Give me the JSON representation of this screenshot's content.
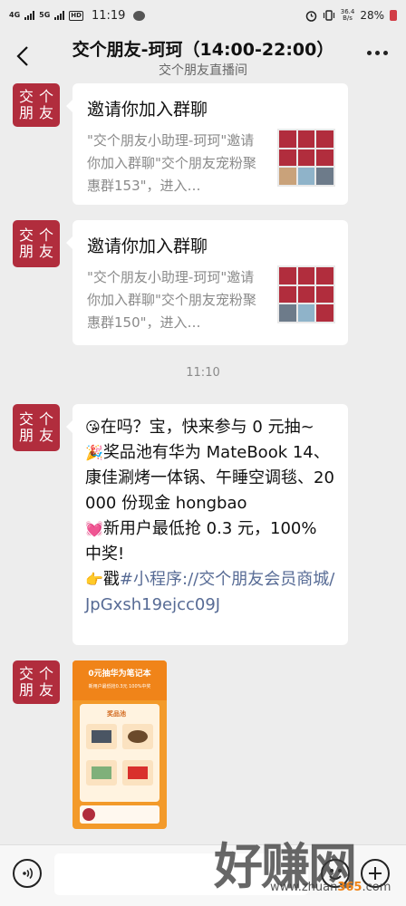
{
  "status_bar": {
    "network_1": "4G",
    "network_2": "5G",
    "hd": "HD",
    "time": "11:19",
    "speed_value": "36.4",
    "speed_unit": "B/s",
    "battery": "28%"
  },
  "header": {
    "title": "交个朋友-珂珂（14:00-22:00）",
    "subtitle": "交个朋友直播间"
  },
  "avatar": {
    "chars": [
      "交",
      "个",
      "朋",
      "友"
    ]
  },
  "messages": {
    "card1": {
      "title": "邀请你加入群聊",
      "desc": "\"交个朋友小助理-珂珂\"邀请你加入群聊\"交个朋友宠粉聚惠群153\"，进入…"
    },
    "card2": {
      "title": "邀请你加入群聊",
      "desc": "\"交个朋友小助理-珂珂\"邀请你加入群聊\"交个朋友宠粉聚惠群150\"，进入…"
    },
    "timestamp": "11:10",
    "text": {
      "emoji1": "😘",
      "line1": "在吗？宝，快来参与 0 元抽~",
      "emoji2": "🎉",
      "line2": "奖品池有华为 MateBook 14、 康佳涮烤一体锅、午睡空调毯、20000 份现金 hongbao",
      "emoji3": "💓",
      "line3": "新用户最低抢 0.3 元，100% 中奖!",
      "emoji4": "👉",
      "line4_prefix": "戳",
      "link": "#小程序://交个朋友会员商城/JpGxsh19ejcc09J"
    },
    "poster": {
      "title": "0元抽华为笔记本",
      "subtitle": "新用户最低抢0.3元 100%中奖",
      "pool_label": "奖品池"
    }
  },
  "input_bar": {
    "placeholder": ""
  },
  "watermark": {
    "big": "好赚网",
    "small_prefix": "www.zhuan",
    "small_accent": "365",
    "small_suffix": ".com"
  }
}
